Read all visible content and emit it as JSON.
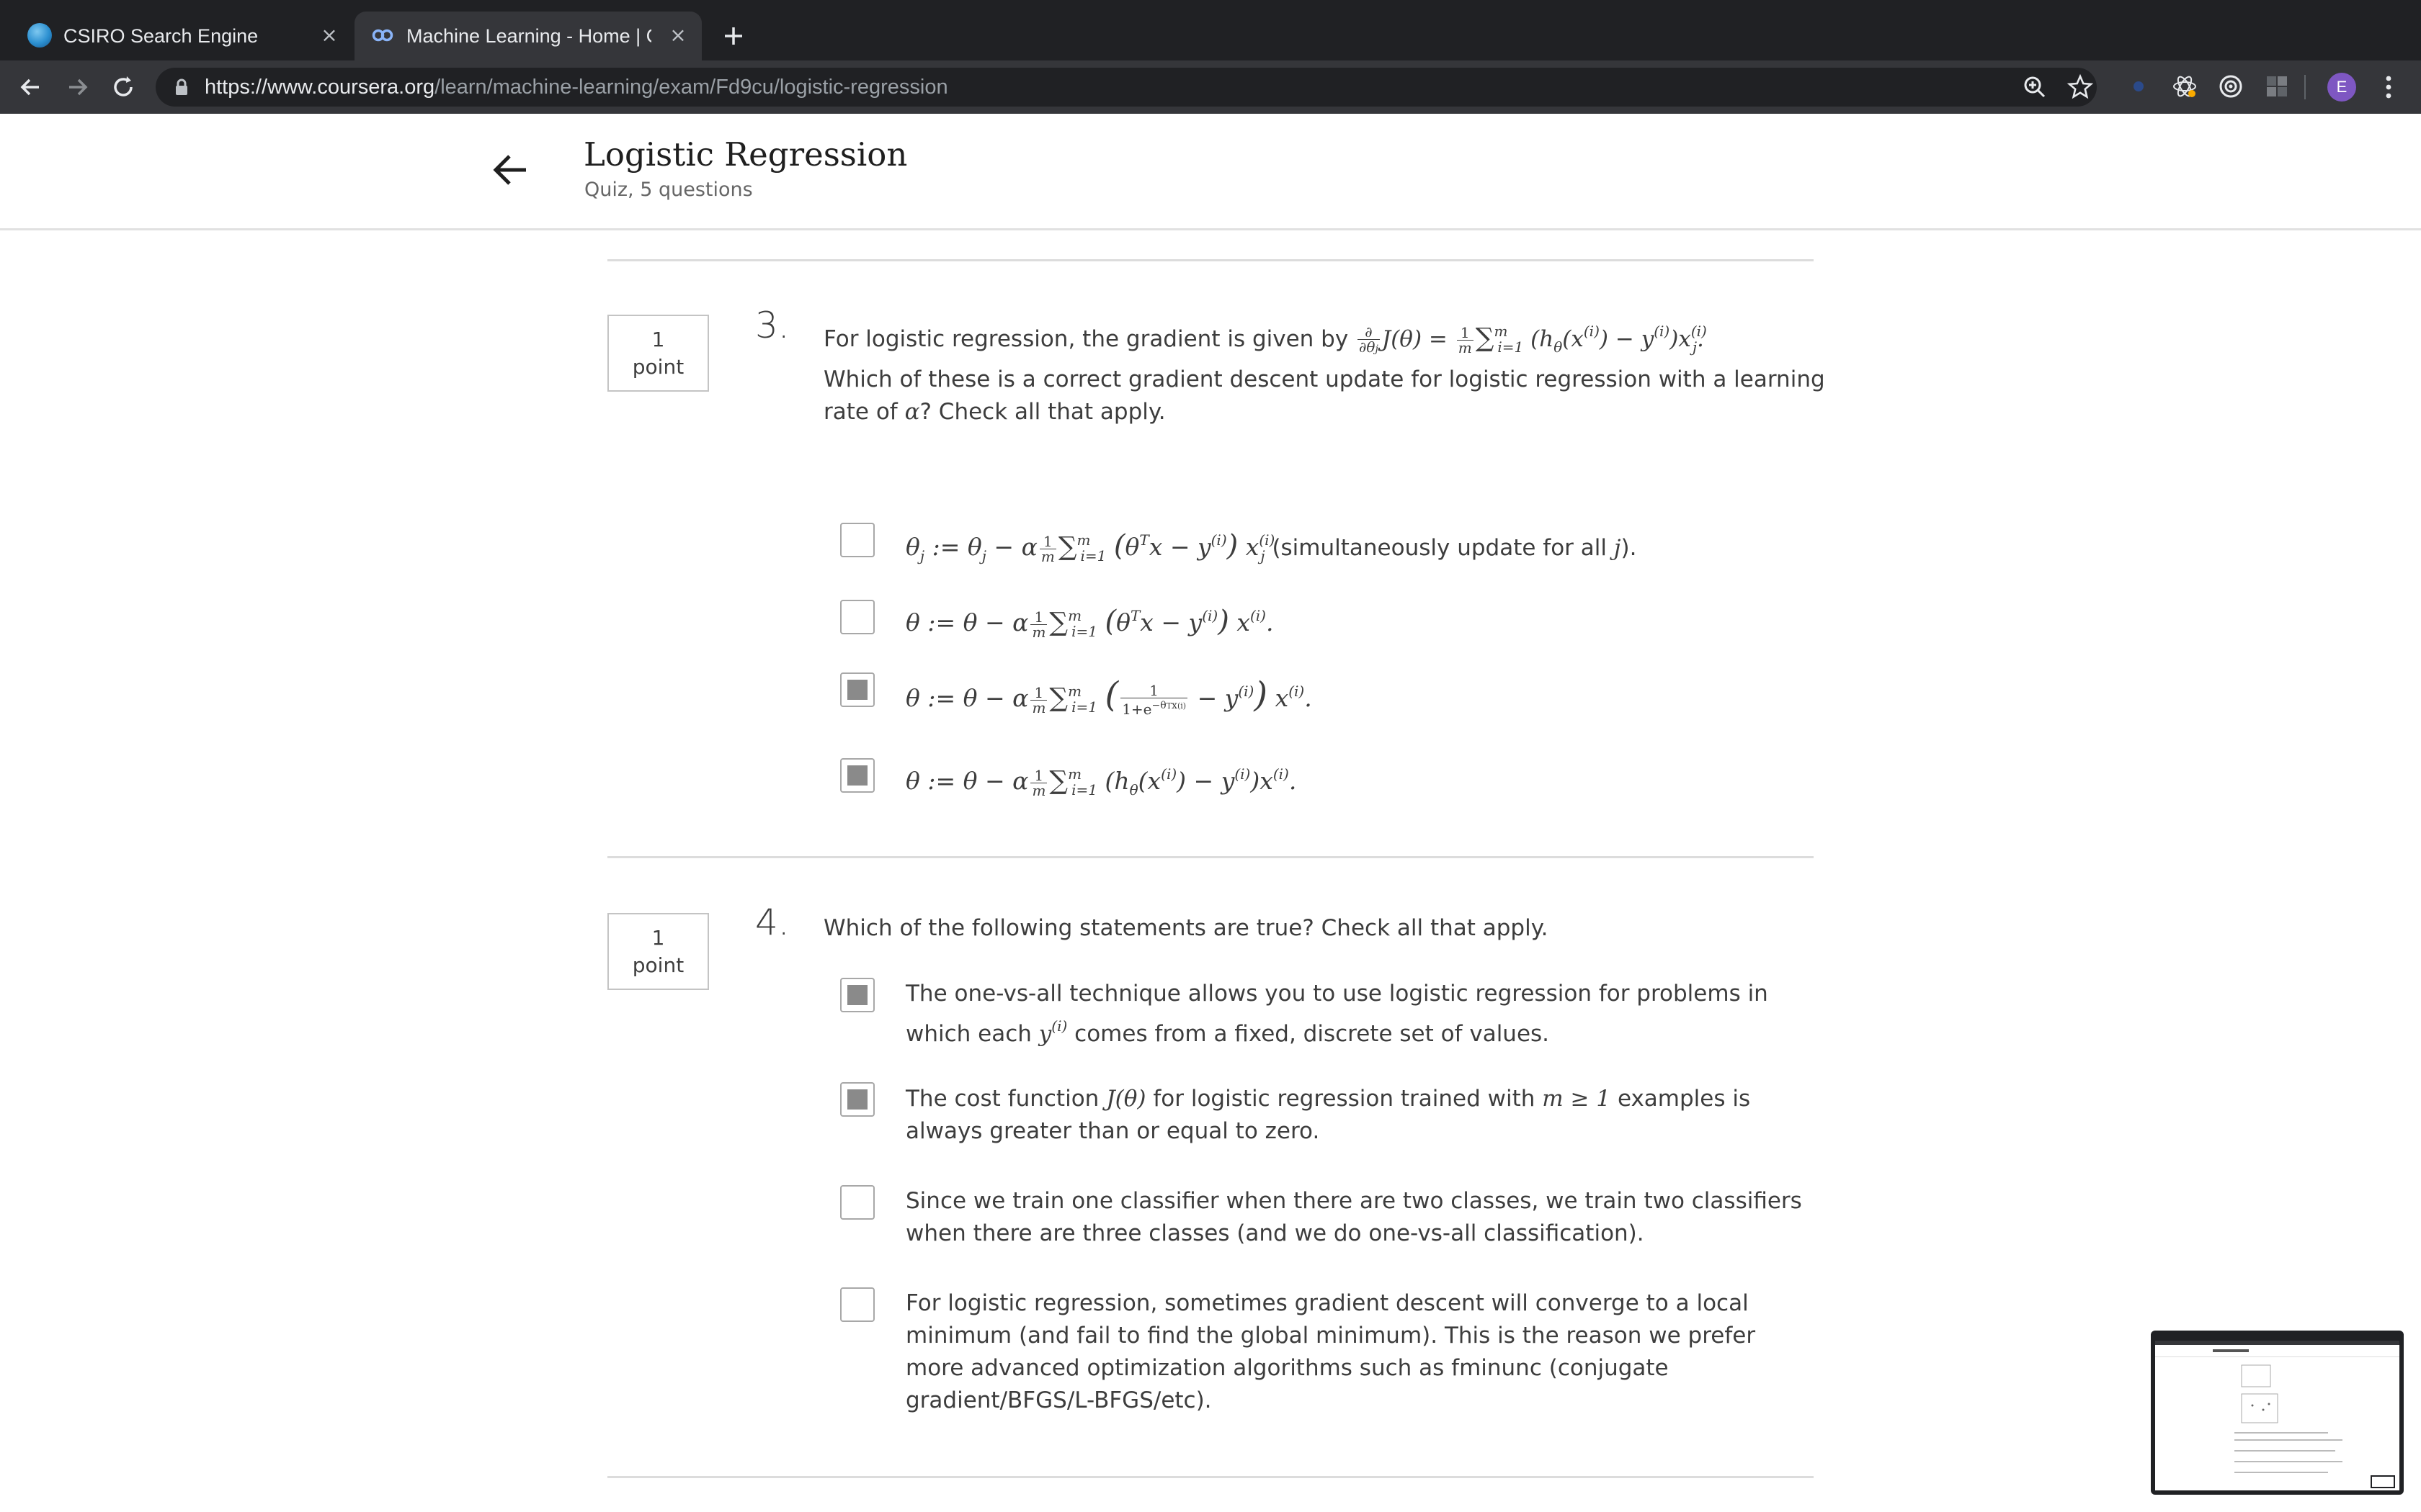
{
  "browser": {
    "tabs": [
      {
        "title": "CSIRO Search Engine",
        "icon": "csiro-globe-icon"
      },
      {
        "title": "Machine Learning - Home | Coursera",
        "icon": "coursera-infinity-icon"
      }
    ],
    "new_tab_icon": "plus-icon",
    "close_glyph": "×",
    "url_host": "https://www.coursera.org",
    "url_path": "/learn/machine-learning/exam/Fd9cu/logistic-regression",
    "profile_initial": "E"
  },
  "header": {
    "title": "Logistic Regression",
    "subtitle": "Quiz, 5 questions"
  },
  "questions": [
    {
      "number": "3.",
      "points_num": "1",
      "points_unit": "point",
      "prompt_lead": "For logistic regression, the gradient is given by",
      "prompt_line2": "Which of these is a correct gradient descent update for logistic regression with a learning",
      "prompt_line3_pre": "rate of",
      "prompt_line3_post": "? Check all that apply.",
      "options": [
        {
          "text_suffix": "(simultaneously update for all",
          "text_end": ").",
          "checked": false
        },
        {
          "checked": false
        },
        {
          "checked": true
        },
        {
          "checked": true
        }
      ]
    },
    {
      "number": "4.",
      "points_num": "1",
      "points_unit": "point",
      "prompt": "Which of the following statements are true? Check all that apply.",
      "options": [
        {
          "line1": "The one-vs-all technique allows you to use logistic regression for problems in",
          "line2_pre": "which each",
          "line2_post": "comes from a fixed, discrete set of values.",
          "checked": true
        },
        {
          "line1_pre": "The cost function",
          "line1_mid": "for logistic regression trained with",
          "line1_post": "examples is",
          "line2": "always greater than or equal to zero.",
          "checked": true
        },
        {
          "line1": "Since we train one classifier when there are two classes, we train two classifiers",
          "line2": "when there are three classes (and we do one-vs-all classification).",
          "checked": false
        },
        {
          "line1": "For logistic regression, sometimes gradient descent will converge to a local",
          "line2": "minimum (and fail to find the global minimum). This is the reason we prefer",
          "line3": "more advanced optimization algorithms such as fminunc (conjugate",
          "line4": "gradient/BFGS/L-BFGS/etc).",
          "checked": false
        }
      ]
    }
  ],
  "colors": {
    "tabstrip": "#202124",
    "toolbar": "#35363a",
    "checked_fill": "#8a8a8a",
    "avatar": "#7e57c2"
  }
}
